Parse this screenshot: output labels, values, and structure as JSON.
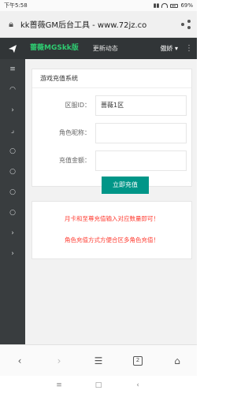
{
  "status_bar": {
    "time": "下午5:58",
    "battery": "69%"
  },
  "address_bar": {
    "url_text": "kk蔷薇GM后台工具 - www.72jz.co"
  },
  "top_nav": {
    "brand": "蔷薇MGSkk版",
    "link": "更新动态",
    "user": "傲娇 ▾",
    "more": "⋮"
  },
  "sidebar": {
    "items": [
      "≡",
      "◠",
      "›",
      "⌟",
      "○",
      "○",
      "○",
      "○",
      "›",
      "›"
    ]
  },
  "form": {
    "title": "游戏充值系统",
    "zone_label": "区服ID：",
    "zone_value": "蔷薇1区",
    "role_label": "角色昵称：",
    "role_value": "",
    "amount_label": "充值金额：",
    "amount_value": "",
    "submit_label": "立即充值"
  },
  "notice": {
    "line1": "月卡和至尊充值输入对应数量即可！",
    "line2": "角色充值方式方便合区多角色充值！"
  },
  "browser_bar": {
    "back": "‹",
    "forward": "›",
    "menu": "☰",
    "tab_count": "2",
    "home": "⌂"
  },
  "android_nav": {
    "recent": "≡",
    "home": "□",
    "back": "‹"
  },
  "colors": {
    "accent": "#009688",
    "brand": "#2ecc71",
    "nav_bg": "#313537",
    "notice_red": "#ff3b30"
  }
}
